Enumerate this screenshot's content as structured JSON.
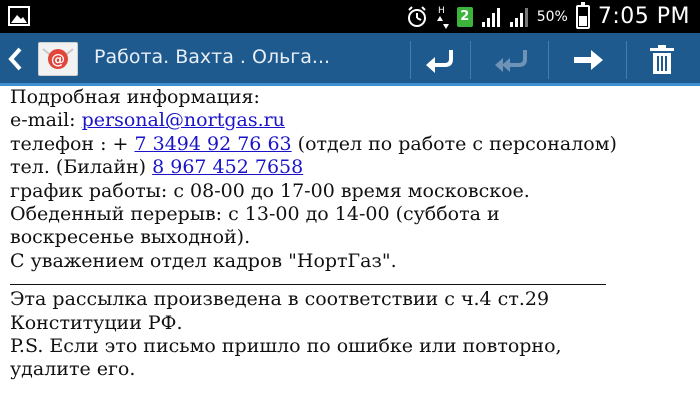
{
  "status_bar": {
    "sim_label": "2",
    "battery_level": "50%",
    "time": "7:05 PM",
    "icons": [
      "picture-icon",
      "alarm-icon",
      "data-arrows-icon",
      "sim-card-icon",
      "signal-icon",
      "battery-icon"
    ]
  },
  "action_bar": {
    "subject": "Работа. Вахта .    Ольга...",
    "icons": [
      "back-chevron-icon",
      "email-app-icon",
      "reply-icon",
      "reply-all-icon",
      "forward-icon",
      "trash-icon"
    ]
  },
  "email": {
    "line1": "Подробная информация:",
    "email_label": "e-mail:  ",
    "email_link": "personal@nortgas.ru",
    "phone_label": "телефон : + ",
    "phone_link": "7 3494 92 76 63",
    "phone_note": " (отдел по работе с персоналом)",
    "beeline_label": "тел. (Билайн) ",
    "beeline_link": "8 967 452 7658",
    "schedule": "график работы:  с 08-00  до 17-00  время московское.",
    "lunch1": "Обеденный перерыв: с 13-00 до 14-00 (суббота  и",
    "lunch2": "воскресенье  выходной).",
    "signature": "С уважением отдел кадров \"НортГаз\".",
    "notice1": "Эта рассылка произведена в соответствии с ч.4 ст.29",
    "notice2": "Конституции РФ.",
    "ps1": "P.S. Если это письмо пришло по ошибке или повторно,",
    "ps2": "удалите его."
  },
  "colors": {
    "action_bar": "#1f5a8e",
    "action_bar_border": "#3e8fd0",
    "link": "#1a13c8",
    "status_bar": "#000000"
  }
}
